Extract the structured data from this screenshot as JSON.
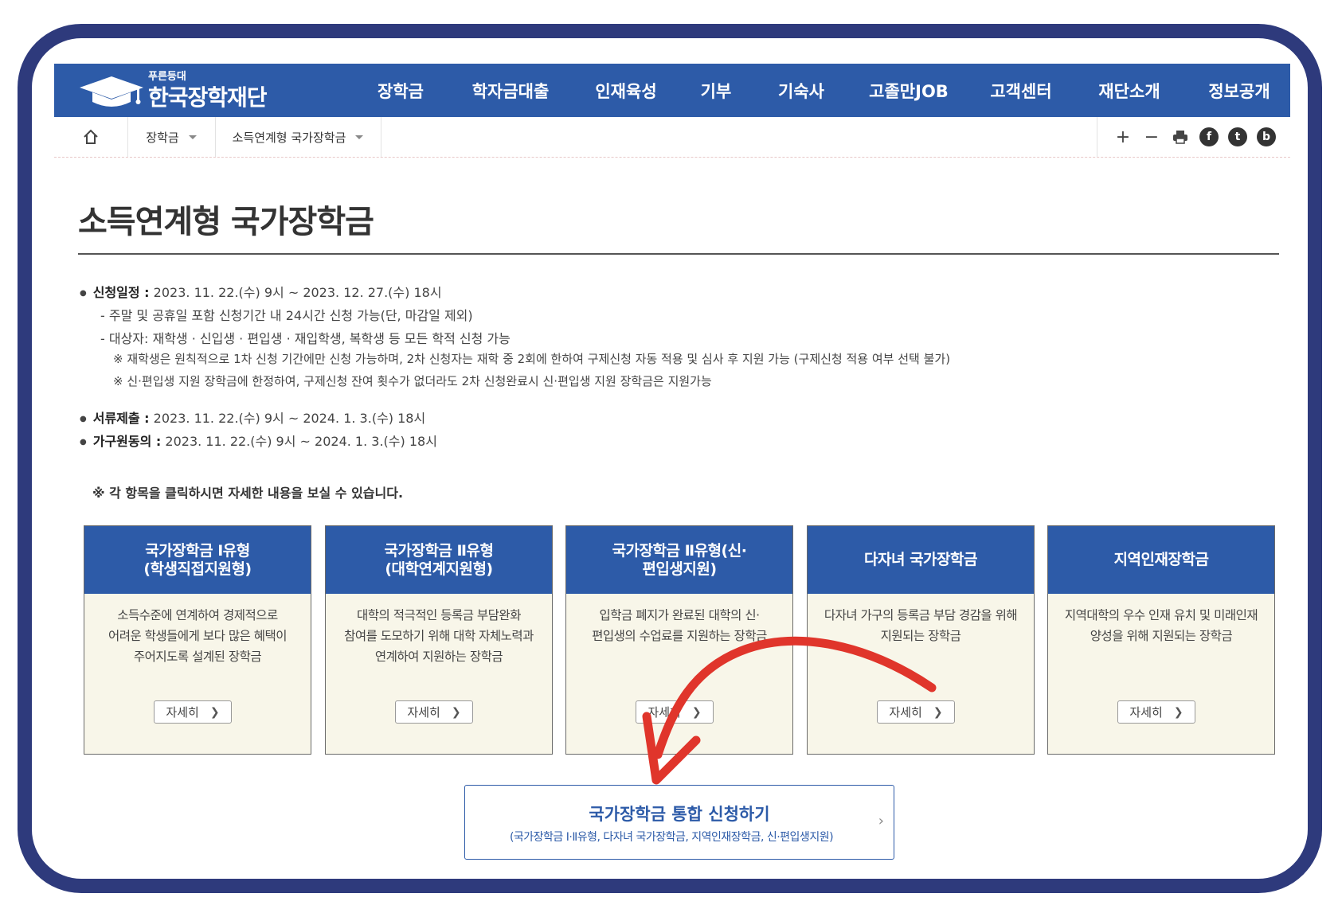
{
  "header": {
    "logo_small": "푸른등대",
    "logo_name": "한국장학재단",
    "menu": [
      "장학금",
      "학자금대출",
      "인재육성",
      "기부",
      "기숙사",
      "고졸만JOB",
      "고객센터",
      "재단소개",
      "정보공개"
    ]
  },
  "breadcrumb": {
    "home_icon": "home-icon",
    "level1": "장학금",
    "level2": "소득연계형 국가장학금"
  },
  "tools": {
    "zoom_in": "+",
    "zoom_out": "−",
    "print_icon": "print-icon",
    "facebook": "f",
    "twitter": "t",
    "blog": "b"
  },
  "page_title": "소득연계형 국가장학금",
  "schedule": {
    "apply_label": "신청일정 :",
    "apply_value": " 2023. 11. 22.(수) 9시 ~ 2023. 12. 27.(수) 18시",
    "sub1": "- 주말 및 공휴일 포함 신청기간 내 24시간 신청 가능(단, 마감일 제외)",
    "sub2": "- 대상자: 재학생 · 신입생 · 편입생 · 재입학생, 복학생 등 모든 학적 신청 가능",
    "note1": "※ 재학생은 원칙적으로 1차 신청 기간에만 신청 가능하며, 2차 신청자는 재학 중 2회에 한하여 구제신청 자동 적용 및 심사 후 지원 가능 (구제신청 적용 여부 선택 불가)",
    "note2": "※ 신·편입생 지원 장학금에 한정하여, 구제신청 잔여 횟수가 없더라도 2차 신청완료시 신·편입생 지원 장학금은 지원가능",
    "docs_label": "서류제출 :",
    "docs_value": " 2023. 11. 22.(수) 9시 ~ 2024. 1. 3.(수) 18시",
    "family_label": "가구원동의 :",
    "family_value": " 2023. 11. 22.(수) 9시 ~ 2024. 1. 3.(수) 18시"
  },
  "notice": "※ 각 항목을 클릭하시면 자세한 내용을 보실 수 있습니다.",
  "cards": [
    {
      "title": "국가장학금 Ⅰ유형\n(학생직접지원형)",
      "desc": "소득수준에 연계하여 경제적으로\n어려운 학생들에게 보다 많은 혜택이\n주어지도록 설계된 장학금",
      "button": "자세히"
    },
    {
      "title": "국가장학금 Ⅱ유형\n(대학연계지원형)",
      "desc": "대학의 적극적인 등록금 부담완화\n참여를 도모하기 위해 대학 자체노력과\n연계하여 지원하는 장학금",
      "button": "자세히"
    },
    {
      "title": "국가장학금 Ⅱ유형(신·\n편입생지원)",
      "desc": "입학금 폐지가 완료된 대학의 신·\n편입생의 수업료를 지원하는 장학금",
      "button": "자세히"
    },
    {
      "title": "다자녀 국가장학금",
      "desc": "다자녀 가구의 등록금 부담 경감을 위해\n지원되는 장학금",
      "button": "자세히"
    },
    {
      "title": "지역인재장학금",
      "desc": "지역대학의 우수 인재 유치 및 미래인재\n양성을 위해 지원되는 장학금",
      "button": "자세히"
    }
  ],
  "apply_button": {
    "label": "국가장학금 통합 신청하기",
    "sub": "(국가장학금 Ⅰ·Ⅱ유형, 다자녀 국가장학금, 지역인재장학금, 신·편입생지원)"
  },
  "colors": {
    "frame": "#2e3a7c",
    "nav": "#2d5ba8",
    "card_bg": "#f8f6e9",
    "annotation_arrow": "#e0352b"
  },
  "annotation": {
    "arrow_icon": "curved-red-arrow-icon"
  }
}
